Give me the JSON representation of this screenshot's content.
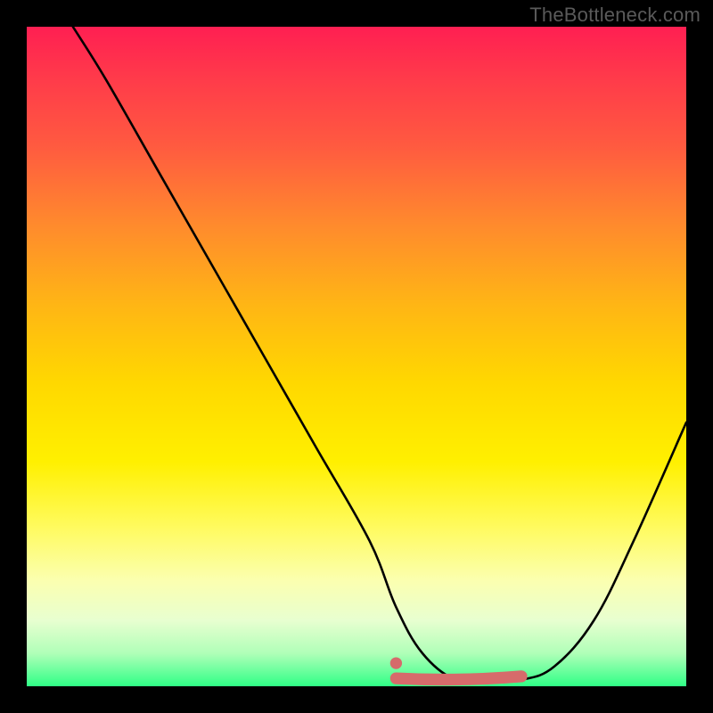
{
  "watermark": "TheBottleneck.com",
  "chart_data": {
    "type": "line",
    "title": "",
    "xlabel": "",
    "ylabel": "",
    "xlim": [
      0,
      100
    ],
    "ylim": [
      0,
      100
    ],
    "grid": false,
    "series": [
      {
        "name": "bottleneck-curve",
        "x": [
          7,
          12,
          20,
          28,
          36,
          44,
          52,
          56,
          60,
          65,
          70,
          75,
          80,
          86,
          92,
          100
        ],
        "y": [
          100,
          92,
          78,
          64,
          50,
          36,
          22,
          12,
          5,
          1,
          1,
          1,
          3,
          10,
          22,
          40
        ],
        "color": "#000000",
        "stroke_width": 2
      }
    ],
    "markers": [
      {
        "name": "highlight-segment",
        "type": "thick-line",
        "x": [
          56,
          75
        ],
        "y": [
          1.2,
          1.5
        ],
        "color": "#d66b6b",
        "stroke_width": 12
      },
      {
        "name": "highlight-dot",
        "type": "dot",
        "x": 56,
        "y": 3.5,
        "color": "#d66b6b",
        "radius": 6
      }
    ],
    "background_gradient": {
      "stops": [
        {
          "pos": 0.0,
          "color": "#ff1f52"
        },
        {
          "pos": 0.3,
          "color": "#ff8a2d"
        },
        {
          "pos": 0.55,
          "color": "#ffd800"
        },
        {
          "pos": 0.8,
          "color": "#fffb60"
        },
        {
          "pos": 1.0,
          "color": "#2fff86"
        }
      ]
    }
  }
}
